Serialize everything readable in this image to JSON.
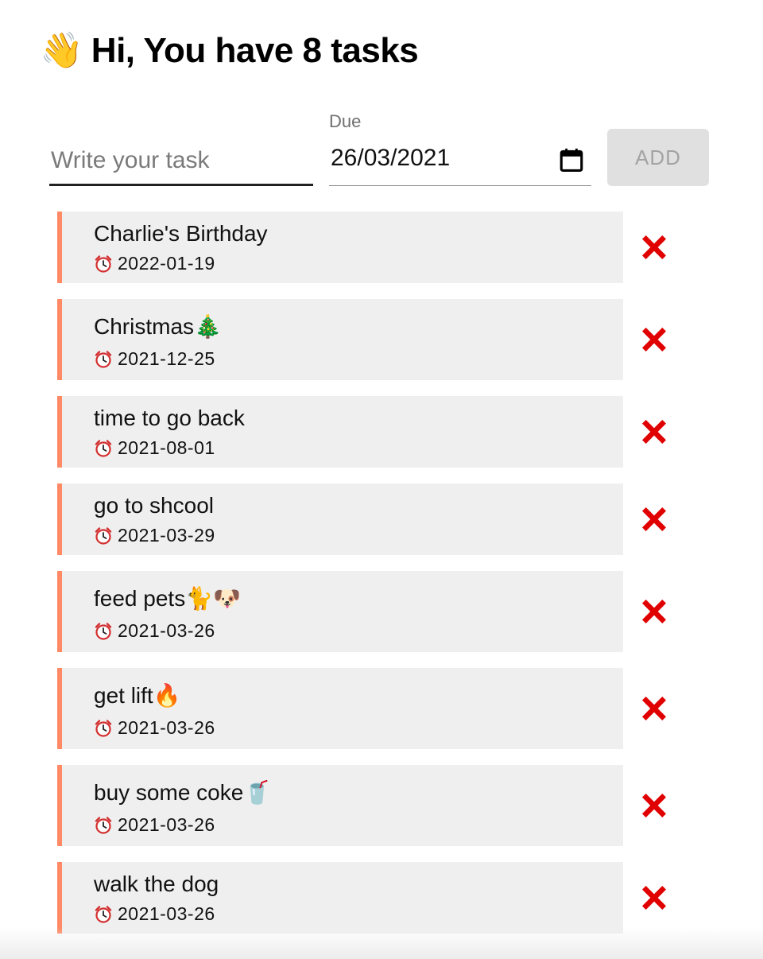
{
  "header": {
    "wave_emoji": "👋",
    "title": "Hi, You have 8 tasks"
  },
  "form": {
    "task_placeholder": "Write your task",
    "task_value": "",
    "due_label": "Due",
    "due_value": "26/03/2021",
    "add_label": "ADD"
  },
  "tasks": [
    {
      "name": "Charlie's Birthday",
      "date": "2022-01-19"
    },
    {
      "name": "Christmas🎄",
      "date": "2021-12-25"
    },
    {
      "name": "time to go back",
      "date": "2021-08-01"
    },
    {
      "name": "go to shcool",
      "date": "2021-03-29"
    },
    {
      "name": "feed pets🐈🐶",
      "date": "2021-03-26"
    },
    {
      "name": "get lift🔥",
      "date": "2021-03-26"
    },
    {
      "name": "buy some coke🥤",
      "date": "2021-03-26"
    },
    {
      "name": "walk the dog",
      "date": "2021-03-26"
    }
  ],
  "colors": {
    "accent": "#ff8a65",
    "card_bg": "#efefef",
    "delete": "#e00000"
  },
  "icons": {
    "header": "waving-hand-icon",
    "calendar": "calendar-icon",
    "alarm": "alarm-clock-icon",
    "delete": "close-x-icon"
  }
}
